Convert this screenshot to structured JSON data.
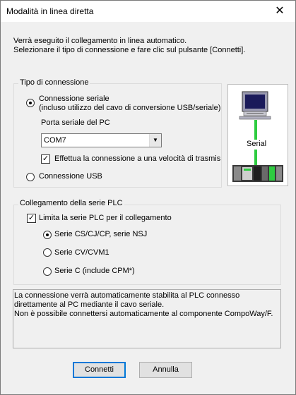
{
  "window": {
    "title": "Modalità in linea diretta",
    "close_glyph": "✕"
  },
  "intro": {
    "line1": "Verrà eseguito il collegamento in linea automatico.",
    "line2": "Selezionare il tipo di connessione e fare clic sul pulsante [Connetti]."
  },
  "connection_type": {
    "legend": "Tipo di connessione",
    "serial_label": "Connessione seriale",
    "serial_sublabel": "(incluso utilizzo del cavo di conversione USB/seriale)",
    "port_label": "Porta seriale del PC",
    "port_value": "COM7",
    "speed_checkbox_label": "Effettua la connessione a una velocità di trasmis",
    "usb_label": "Connessione USB",
    "selected": "serial",
    "speed_checked": true
  },
  "illustration": {
    "label": "Serial",
    "icon": "pc-to-plc-serial-icon",
    "link_color": "#2ecc40"
  },
  "plc_series": {
    "legend": "Collegamento della serie PLC",
    "limit_checkbox_label": "Limita la serie PLC per il collegamento",
    "limit_checked": true,
    "options": [
      {
        "label": "Serie CS/CJ/CP, serie NSJ",
        "selected": true
      },
      {
        "label": "Serie CV/CVM1",
        "selected": false
      },
      {
        "label": "Serie C (include CPM*)",
        "selected": false
      }
    ]
  },
  "info": {
    "text": "La connessione verrà automaticamente stabilita al PLC connesso direttamente al PC mediante il cavo seriale.\nNon è possibile connettersi automaticamente al componente CompoWay/F."
  },
  "buttons": {
    "connect": "Connetti",
    "cancel": "Annulla"
  }
}
